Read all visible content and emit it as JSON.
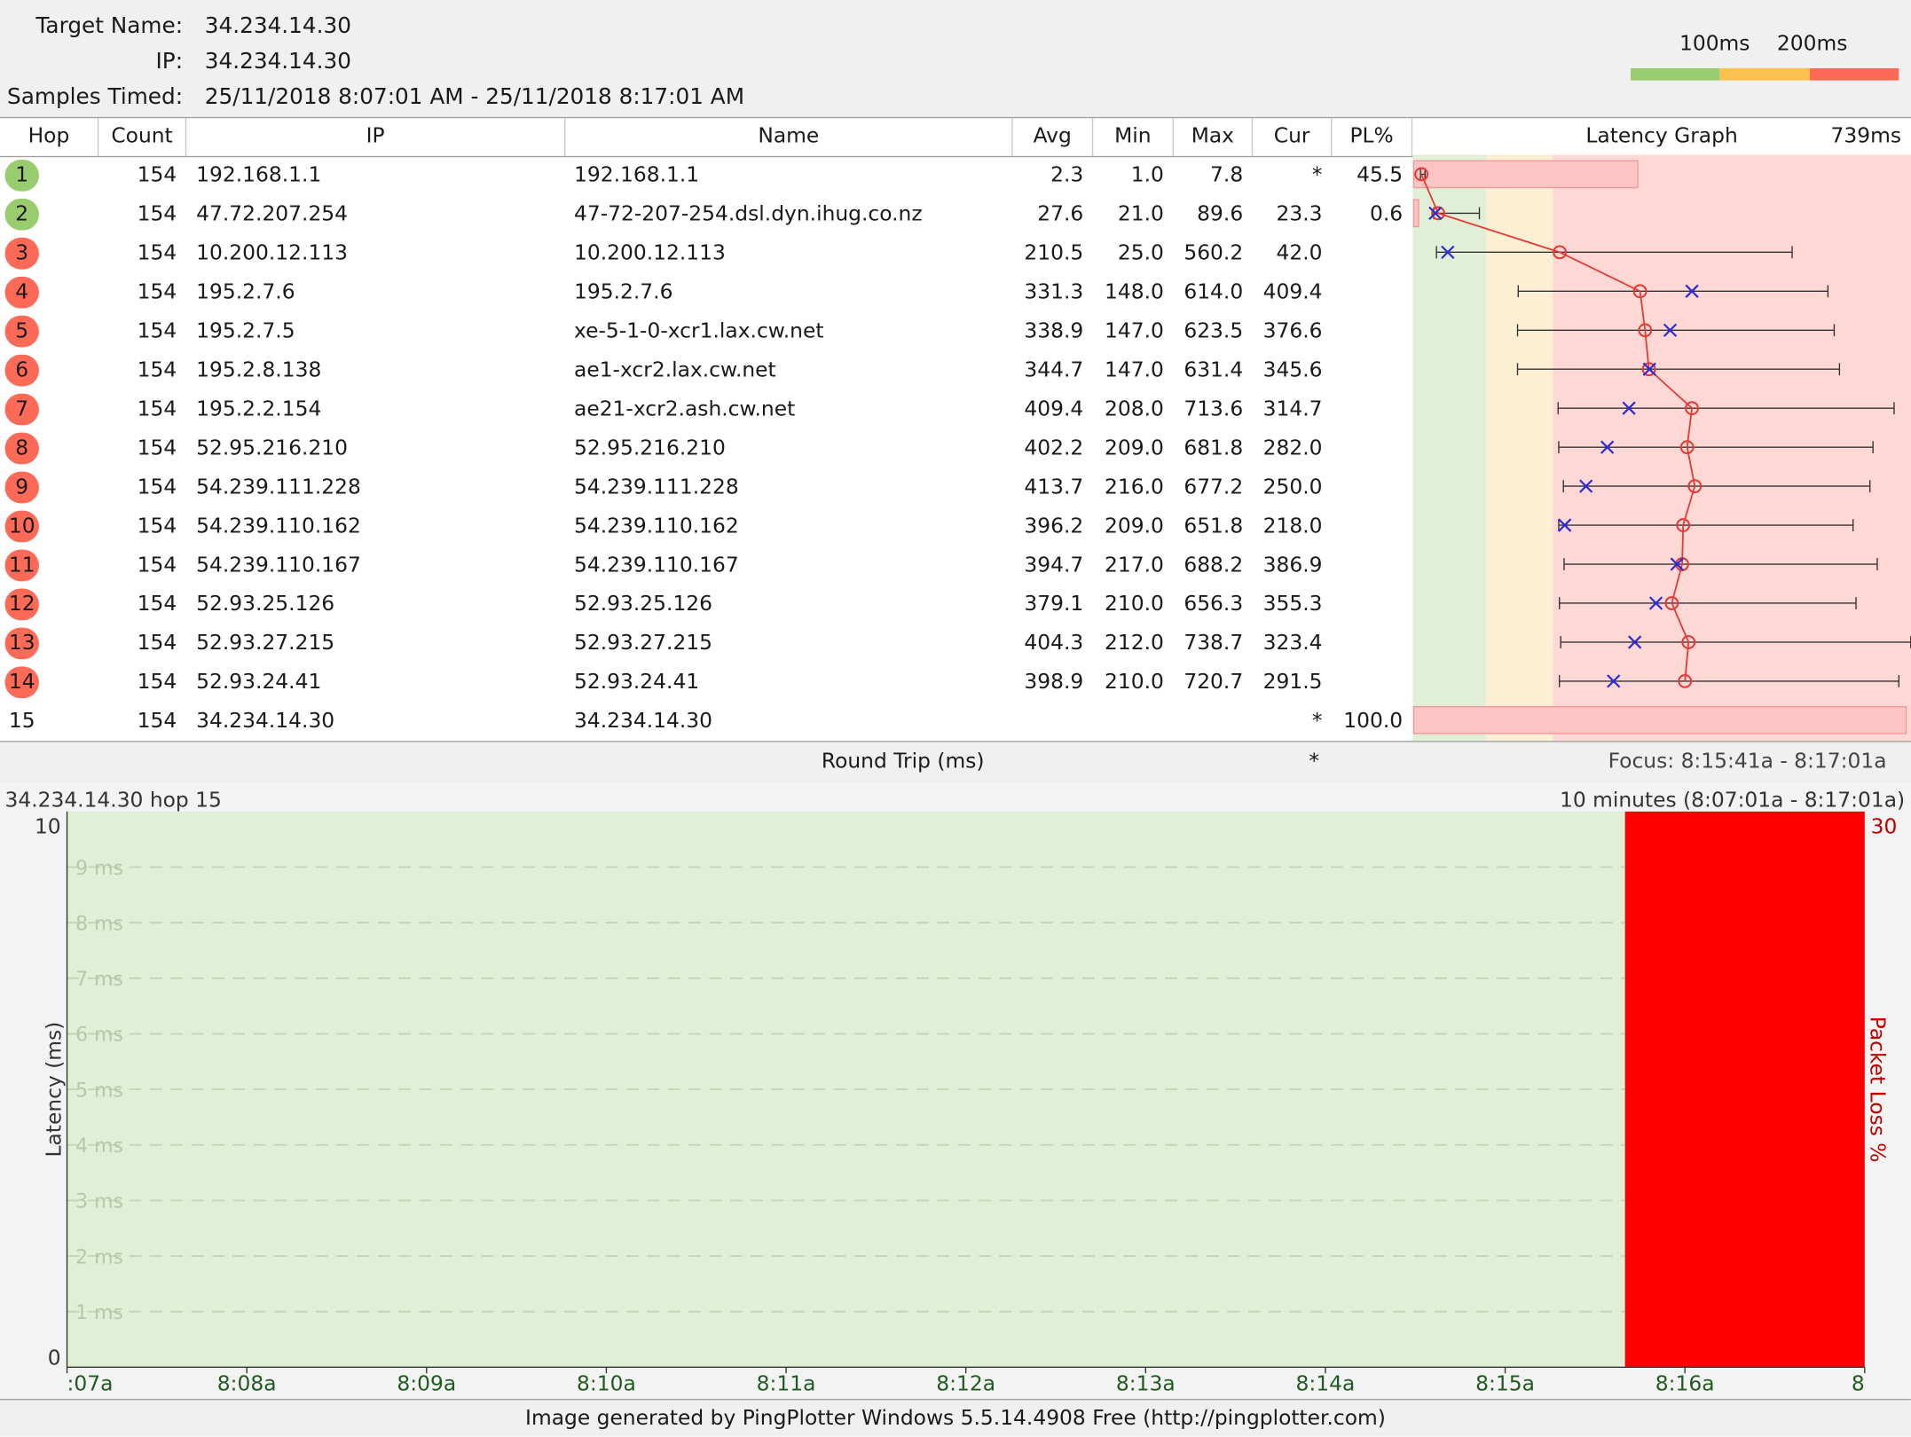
{
  "header": {
    "target_label": "Target Name:",
    "target_value": "34.234.14.30",
    "ip_label": "IP:",
    "ip_value": "34.234.14.30",
    "samples_label": "Samples Timed:",
    "samples_value": "25/11/2018 8:07:01 AM - 25/11/2018 8:17:01 AM",
    "legend_100": "100ms",
    "legend_200": "200ms",
    "legend_colors": [
      "#99cc6e",
      "#fdc151",
      "#fd6a57"
    ]
  },
  "columns": {
    "hop": "Hop",
    "count": "Count",
    "ip": "IP",
    "name": "Name",
    "avg": "Avg",
    "min": "Min",
    "max": "Max",
    "cur": "Cur",
    "pl": "PL%",
    "graph": "Latency Graph",
    "graph_scale": "739ms"
  },
  "hops": [
    {
      "hop": "1",
      "count": "154",
      "ip": "192.168.1.1",
      "name": "192.168.1.1",
      "avg": "2.3",
      "min": "1.0",
      "max": "7.8",
      "cur": "*",
      "pl": "45.5",
      "status": "green"
    },
    {
      "hop": "2",
      "count": "154",
      "ip": "47.72.207.254",
      "name": "47-72-207-254.dsl.dyn.ihug.co.nz",
      "avg": "27.6",
      "min": "21.0",
      "max": "89.6",
      "cur": "23.3",
      "pl": "0.6",
      "status": "green"
    },
    {
      "hop": "3",
      "count": "154",
      "ip": "10.200.12.113",
      "name": "10.200.12.113",
      "avg": "210.5",
      "min": "25.0",
      "max": "560.2",
      "cur": "42.0",
      "pl": "",
      "status": "red"
    },
    {
      "hop": "4",
      "count": "154",
      "ip": "195.2.7.6",
      "name": "195.2.7.6",
      "avg": "331.3",
      "min": "148.0",
      "max": "614.0",
      "cur": "409.4",
      "pl": "",
      "status": "red"
    },
    {
      "hop": "5",
      "count": "154",
      "ip": "195.2.7.5",
      "name": "xe-5-1-0-xcr1.lax.cw.net",
      "avg": "338.9",
      "min": "147.0",
      "max": "623.5",
      "cur": "376.6",
      "pl": "",
      "status": "red"
    },
    {
      "hop": "6",
      "count": "154",
      "ip": "195.2.8.138",
      "name": "ae1-xcr2.lax.cw.net",
      "avg": "344.7",
      "min": "147.0",
      "max": "631.4",
      "cur": "345.6",
      "pl": "",
      "status": "red"
    },
    {
      "hop": "7",
      "count": "154",
      "ip": "195.2.2.154",
      "name": "ae21-xcr2.ash.cw.net",
      "avg": "409.4",
      "min": "208.0",
      "max": "713.6",
      "cur": "314.7",
      "pl": "",
      "status": "red"
    },
    {
      "hop": "8",
      "count": "154",
      "ip": "52.95.216.210",
      "name": "52.95.216.210",
      "avg": "402.2",
      "min": "209.0",
      "max": "681.8",
      "cur": "282.0",
      "pl": "",
      "status": "red"
    },
    {
      "hop": "9",
      "count": "154",
      "ip": "54.239.111.228",
      "name": "54.239.111.228",
      "avg": "413.7",
      "min": "216.0",
      "max": "677.2",
      "cur": "250.0",
      "pl": "",
      "status": "red"
    },
    {
      "hop": "10",
      "count": "154",
      "ip": "54.239.110.162",
      "name": "54.239.110.162",
      "avg": "396.2",
      "min": "209.0",
      "max": "651.8",
      "cur": "218.0",
      "pl": "",
      "status": "red"
    },
    {
      "hop": "11",
      "count": "154",
      "ip": "54.239.110.167",
      "name": "54.239.110.167",
      "avg": "394.7",
      "min": "217.0",
      "max": "688.2",
      "cur": "386.9",
      "pl": "",
      "status": "red"
    },
    {
      "hop": "12",
      "count": "154",
      "ip": "52.93.25.126",
      "name": "52.93.25.126",
      "avg": "379.1",
      "min": "210.0",
      "max": "656.3",
      "cur": "355.3",
      "pl": "",
      "status": "red"
    },
    {
      "hop": "13",
      "count": "154",
      "ip": "52.93.27.215",
      "name": "52.93.27.215",
      "avg": "404.3",
      "min": "212.0",
      "max": "738.7",
      "cur": "323.4",
      "pl": "",
      "status": "red"
    },
    {
      "hop": "14",
      "count": "154",
      "ip": "52.93.24.41",
      "name": "52.93.24.41",
      "avg": "398.9",
      "min": "210.0",
      "max": "720.7",
      "cur": "291.5",
      "pl": "",
      "status": "red"
    },
    {
      "hop": "15",
      "count": "154",
      "ip": "34.234.14.30",
      "name": "34.234.14.30",
      "avg": "",
      "min": "",
      "max": "",
      "cur": "*",
      "pl": "100.0",
      "status": "none"
    }
  ],
  "roundtrip": {
    "label": "Round Trip (ms)",
    "cur": "*",
    "focus": "Focus: 8:15:41a - 8:17:01a"
  },
  "timeline": {
    "title": "34.234.14.30 hop 15",
    "range": "10 minutes (8:07:01a - 8:17:01a)",
    "y_top": "10",
    "y_bottom": "0",
    "y_ticks": [
      "9 ms",
      "8 ms",
      "7 ms",
      "6 ms",
      "5 ms",
      "4 ms",
      "3 ms",
      "2 ms",
      "1 ms"
    ],
    "y_axis_label": "Latency (ms)",
    "loss_top": "30",
    "loss_axis_label": "Packet Loss %",
    "x_ticks": [
      ":07a",
      "8:08a",
      "8:09a",
      "8:10a",
      "8:11a",
      "8:12a",
      "8:13a",
      "8:14a",
      "8:15a",
      "8:16a",
      "8"
    ]
  },
  "footer": "Image generated by PingPlotter Windows 5.5.14.4908 Free (http://pingplotter.com)"
}
